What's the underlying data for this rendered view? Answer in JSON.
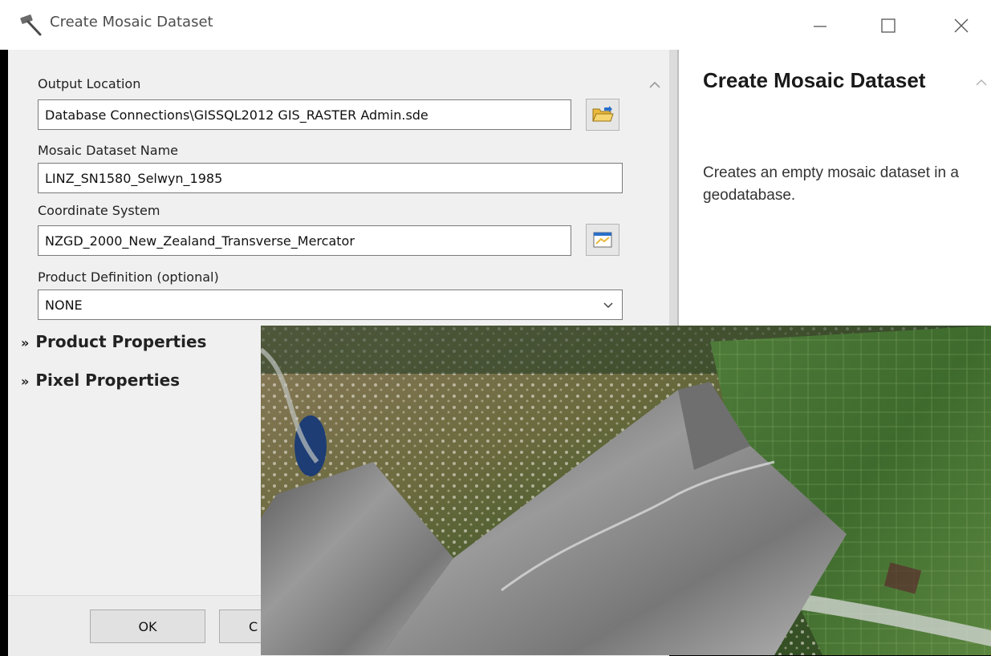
{
  "window": {
    "title": "Create Mosaic Dataset"
  },
  "form": {
    "output_location": {
      "label": "Output Location",
      "value": "Database Connections\\GISSQL2012 GIS_RASTER Admin.sde"
    },
    "mosaic_name": {
      "label": "Mosaic Dataset Name",
      "value": "LINZ_SN1580_Selwyn_1985"
    },
    "coordinate_system": {
      "label": "Coordinate System",
      "value": "NZGD_2000_New_Zealand_Transverse_Mercator"
    },
    "product_definition": {
      "label": "Product Definition (optional)",
      "value": "NONE"
    },
    "sections": {
      "product_properties": "Product Properties",
      "pixel_properties": "Pixel Properties"
    }
  },
  "buttons": {
    "ok": "OK",
    "cancel_partial": "C"
  },
  "help": {
    "title": "Create Mosaic Dataset",
    "description": "Creates an empty mosaic dataset in a geodatabase."
  },
  "icons": {
    "title": "hammer-icon",
    "browse_output": "folder-open-icon",
    "browse_coord": "spatial-reference-icon",
    "dropdown": "chevron-down-icon",
    "section": "double-chevron-down-icon"
  },
  "colors": {
    "window_bg": "#f0f0f0",
    "help_bg": "#ffffff",
    "input_border": "#7a7a7a"
  }
}
